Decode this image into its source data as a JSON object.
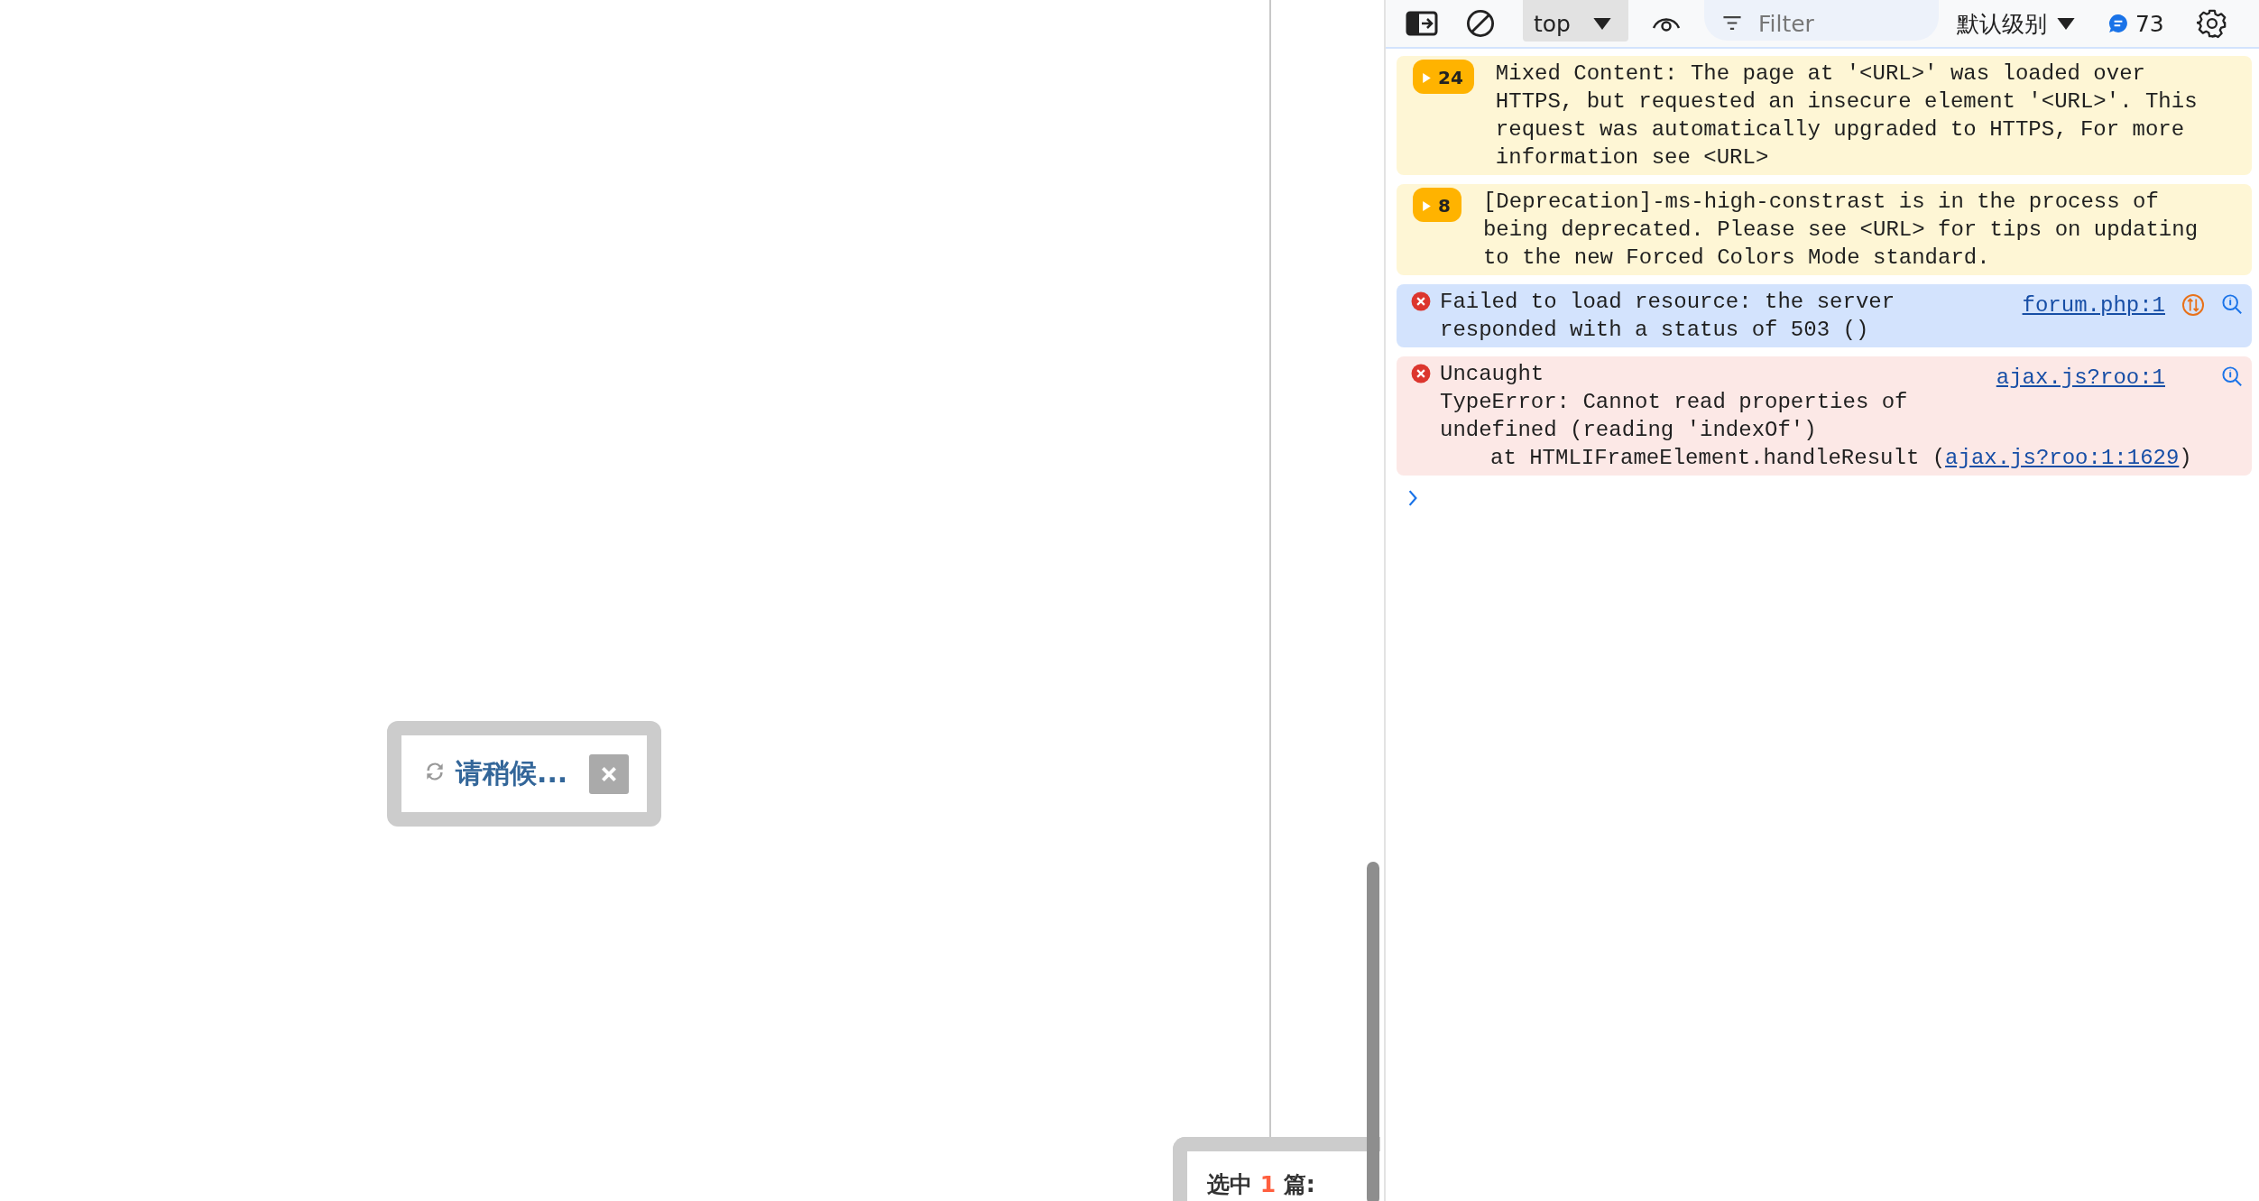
{
  "page": {
    "loading_dialog": {
      "text": "请稍候..."
    },
    "selection_panel": {
      "prefix": "选中",
      "count": "1",
      "suffix": "篇:"
    }
  },
  "toolbar": {
    "context": "top",
    "filter_placeholder": "Filter",
    "level": "默认级别",
    "issues_count": "73"
  },
  "messages": [
    {
      "kind": "warning",
      "selected": false,
      "count": "24",
      "text": "Mixed Content: The page at '<URL>' was loaded over HTTPS, but requested an insecure element '<URL>'. This request was automatically upgraded to HTTPS, For more information see <URL>"
    },
    {
      "kind": "warning",
      "selected": false,
      "count": "8",
      "text": "[Deprecation]-ms-high-constrast is in the process of being deprecated. Please see <URL> for tips on updating to the new Forced Colors Mode standard."
    },
    {
      "kind": "network-error",
      "selected": true,
      "text": "Failed to load resource: the server responded with a status of 503 ()",
      "source": "forum.php:1"
    },
    {
      "kind": "error",
      "selected": false,
      "text": "Uncaught\nTypeError: Cannot read properties of undefined (reading 'indexOf')",
      "source": "ajax.js?roo:1",
      "stack": [
        {
          "prefix": "at HTMLIFrameElement.handleResult (",
          "link": "ajax.js?roo:1:1629",
          "suffix": ")"
        }
      ]
    }
  ]
}
